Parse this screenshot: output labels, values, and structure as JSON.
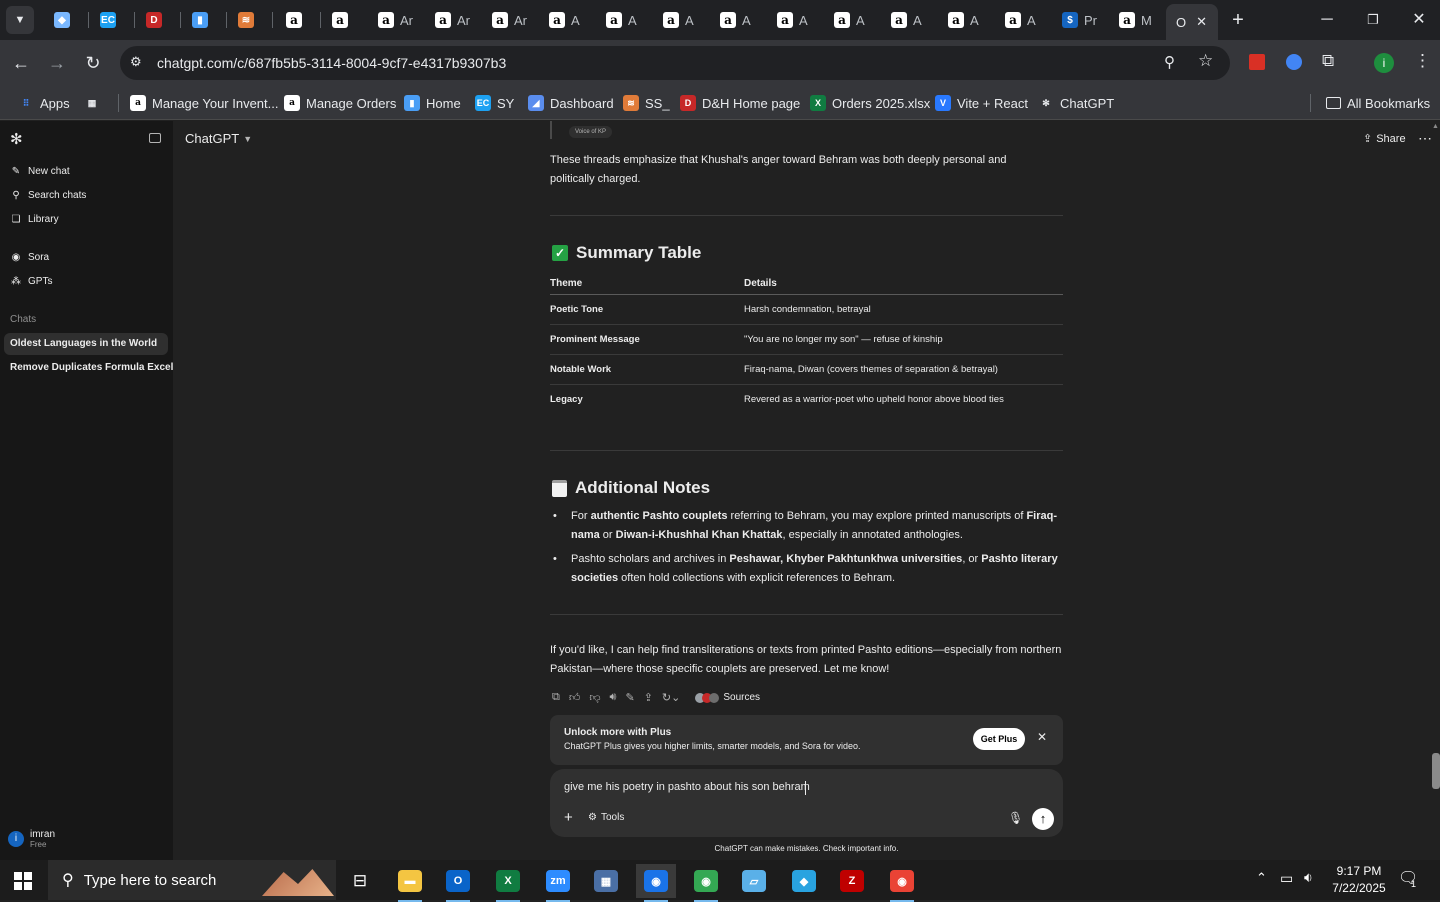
{
  "browser": {
    "tabs": [
      {
        "icon": "diamond-icon",
        "label": ""
      },
      {
        "icon": "ec-icon",
        "label": ""
      },
      {
        "icon": "dh-icon",
        "label": ""
      },
      {
        "icon": "notebook-icon",
        "label": ""
      },
      {
        "icon": "burger-icon",
        "label": ""
      },
      {
        "icon": "amazon-icon",
        "label": ""
      },
      {
        "icon": "amazon-icon",
        "label": ""
      },
      {
        "icon": "amazon-icon",
        "label": "Ar"
      },
      {
        "icon": "amazon-icon",
        "label": "Ar"
      },
      {
        "icon": "amazon-icon",
        "label": "Ar"
      },
      {
        "icon": "amazon-icon",
        "label": "A"
      },
      {
        "icon": "amazon-icon",
        "label": "A"
      },
      {
        "icon": "amazon-icon",
        "label": "A"
      },
      {
        "icon": "amazon-icon",
        "label": "A"
      },
      {
        "icon": "amazon-icon",
        "label": "A"
      },
      {
        "icon": "amazon-icon",
        "label": "A"
      },
      {
        "icon": "amazon-icon",
        "label": "A"
      },
      {
        "icon": "amazon-icon",
        "label": "A"
      },
      {
        "icon": "amazon-icon",
        "label": "A"
      },
      {
        "icon": "dollar-icon",
        "label": "Pr"
      },
      {
        "icon": "amazon-icon",
        "label": "M"
      }
    ],
    "active_tab": {
      "label": "O"
    },
    "url": "chatgpt.com/c/687fb5b5-3114-8004-9cf7-e4317b9307b3",
    "bookmarks": [
      {
        "icon": "apps-icon",
        "label": "Apps"
      },
      {
        "icon": "grid-icon",
        "label": ""
      },
      {
        "icon": "amazon-icon",
        "label": "Manage Your Invent..."
      },
      {
        "icon": "amazon-icon",
        "label": "Manage Orders"
      },
      {
        "icon": "notebook-icon",
        "label": "Home"
      },
      {
        "icon": "ec-icon",
        "label": "SY"
      },
      {
        "icon": "dashboard-icon",
        "label": "Dashboard"
      },
      {
        "icon": "ss-icon",
        "label": "SS_"
      },
      {
        "icon": "dh-icon",
        "label": "D&H Home page"
      },
      {
        "icon": "excel-icon",
        "label": "Orders 2025.xlsx"
      },
      {
        "icon": "vite-icon",
        "label": "Vite + React"
      },
      {
        "icon": "chatgpt-icon",
        "label": "ChatGPT"
      }
    ],
    "all_bookmarks": "All Bookmarks",
    "profile_initial": "i"
  },
  "sidebar": {
    "nav": [
      {
        "icon": "pencil-icon",
        "label": "New chat"
      },
      {
        "icon": "search-icon",
        "label": "Search chats"
      },
      {
        "icon": "library-icon",
        "label": "Library"
      }
    ],
    "apps": [
      {
        "icon": "sora-icon",
        "label": "Sora"
      },
      {
        "icon": "gpts-icon",
        "label": "GPTs"
      }
    ],
    "chats_heading": "Chats",
    "chats": [
      "Oldest Languages in the World",
      "Remove Duplicates Formula Excel"
    ],
    "user": {
      "name": "imran",
      "plan": "Free",
      "initial": "i"
    }
  },
  "header": {
    "model": "ChatGPT",
    "share": "Share"
  },
  "conversation": {
    "source_chip": "Voice of KP",
    "intro_para": "These threads emphasize that Khushal's anger toward Behram was both deeply personal and politically charged.",
    "summary_heading": "Summary Table",
    "table": {
      "headers": [
        "Theme",
        "Details"
      ],
      "rows": [
        [
          "Poetic Tone",
          "Harsh condemnation, betrayal"
        ],
        [
          "Prominent Message",
          "\"You are no longer my son\" — refuse of kinship"
        ],
        [
          "Notable Work",
          "Firaq-nama, Diwan (covers themes of separation & betrayal)"
        ],
        [
          "Legacy",
          "Revered as a warrior-poet who upheld honor above blood ties"
        ]
      ]
    },
    "notes_heading": "Additional Notes",
    "notes": [
      [
        {
          "t": "For ",
          "b": false
        },
        {
          "t": "authentic Pashto couplets",
          "b": true
        },
        {
          "t": " referring to Behram, you may explore printed manuscripts of ",
          "b": false
        },
        {
          "t": "Firaq-nama",
          "b": true
        },
        {
          "t": " or ",
          "b": false
        },
        {
          "t": "Diwan-i-Khushhal Khan Khattak",
          "b": true
        },
        {
          "t": ", especially in annotated anthologies.",
          "b": false
        }
      ],
      [
        {
          "t": "Pashto scholars and archives in ",
          "b": false
        },
        {
          "t": "Peshawar, Khyber Pakhtunkhwa universities",
          "b": true
        },
        {
          "t": ", or ",
          "b": false
        },
        {
          "t": "Pashto literary societies",
          "b": true
        },
        {
          "t": " often hold collections with explicit references to Behram.",
          "b": false
        }
      ]
    ],
    "closing_para": "If you'd like, I can help find transliterations or texts from printed Pashto editions—especially from northern Pakistan—where those specific couplets are preserved. Let me know!",
    "sources_label": "Sources"
  },
  "upsell": {
    "title": "Unlock more with Plus",
    "body": "ChatGPT Plus gives you higher limits, smarter models, and Sora for video.",
    "button": "Get Plus"
  },
  "composer": {
    "value": "give me his poetry in pashto about his son behram",
    "tools": "Tools",
    "disclaimer": "ChatGPT can make mistakes. Check important info."
  },
  "taskbar": {
    "search_placeholder": "Type here to search",
    "time": "9:17 PM",
    "date": "7/22/2025",
    "notifications": "1"
  },
  "colors": {
    "accent_green": "#25a244",
    "link_blue": "#1a73e8",
    "excel_green": "#107c41",
    "chrome_bg": "#202124"
  }
}
